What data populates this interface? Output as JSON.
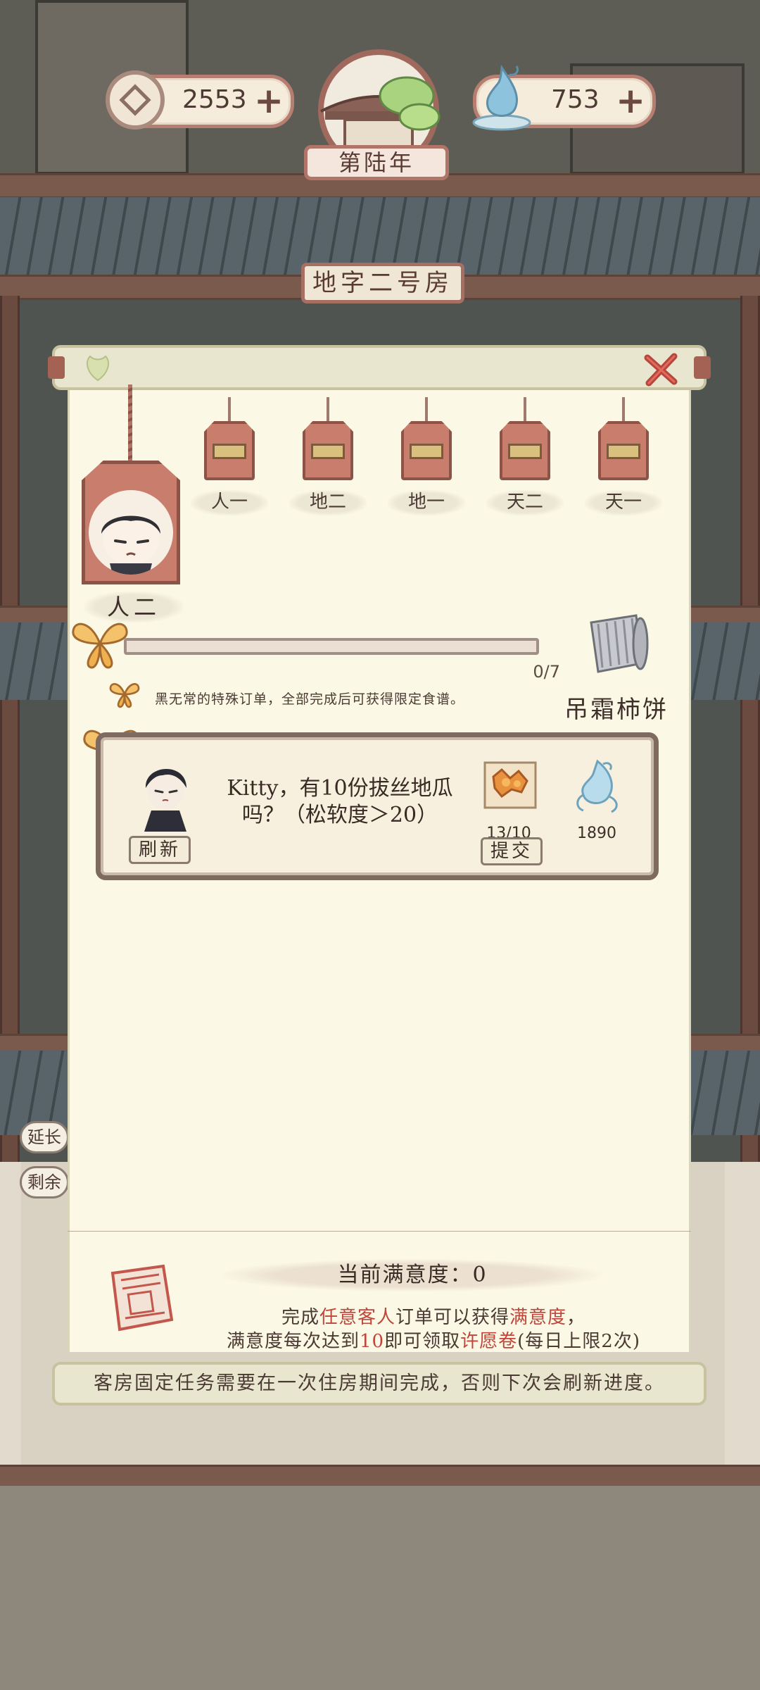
{
  "hud": {
    "coins": "2553",
    "spirit": "753",
    "year": "第陆年",
    "room_title": "地字二号房"
  },
  "side_buttons": {
    "extend": "延长",
    "remain": "剩余"
  },
  "panel": {
    "selected_tag": "人二",
    "tags": [
      "人一",
      "地二",
      "地一",
      "天二",
      "天一"
    ],
    "progress": {
      "current": 0,
      "total": 7,
      "label": "0/7"
    },
    "hint": "黑无常的特殊订单，全部完成后可获得限定食谱。",
    "reward_name": "吊霜柿饼",
    "order": {
      "text": "Kitty，有10份拔丝地瓜吗？（松软度＞20）",
      "food_count": "13/10",
      "reward_count": "1890",
      "refresh_label": "刷新",
      "submit_label": "提交"
    },
    "satisfaction_label": "当前满意度：0",
    "sat_line1": {
      "a": "完成",
      "b": "任意客人",
      "c": "订单可以获得",
      "d": "满意度",
      "e": "，"
    },
    "sat_line2": {
      "a": "满意度每次达到",
      "b": "10",
      "c": "即可领取",
      "d": "许愿卷",
      "e": "(每日上限2次)"
    },
    "footer_note": "客房固定任务需要在一次住房期间完成，否则下次会刷新进度。"
  },
  "colors": {
    "accent": "#c97d6d",
    "highlight_text": "#c0453b",
    "paper": "#fbf8e5"
  }
}
